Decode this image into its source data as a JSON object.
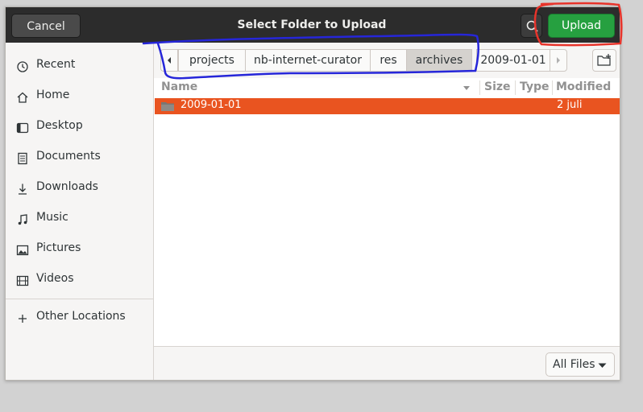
{
  "dialog": {
    "title": "Select Folder to Upload",
    "cancel_label": "Cancel",
    "upload_label": "Upload",
    "search_icon": "search-icon"
  },
  "sidebar": {
    "items": [
      {
        "label": "Recent",
        "icon": "clock-icon"
      },
      {
        "label": "Home",
        "icon": "home-icon"
      },
      {
        "label": "Desktop",
        "icon": "desktop-icon"
      },
      {
        "label": "Documents",
        "icon": "document-icon"
      },
      {
        "label": "Downloads",
        "icon": "download-icon"
      },
      {
        "label": "Music",
        "icon": "music-note-icon"
      },
      {
        "label": "Pictures",
        "icon": "picture-icon"
      },
      {
        "label": "Videos",
        "icon": "film-icon"
      }
    ],
    "other_locations": {
      "label": "Other Locations",
      "icon": "plus-icon"
    }
  },
  "pathbar": {
    "crumbs": [
      "projects",
      "nb-internet-curator",
      "res",
      "archives",
      "2009-01-01"
    ],
    "active_index": 3
  },
  "columns": {
    "name": "Name",
    "size": "Size",
    "type": "Type",
    "modified": "Modified"
  },
  "files": [
    {
      "name": "2009-01-01",
      "size": "",
      "type": "",
      "modified": "2 juli",
      "selected": true,
      "icon": "folder-icon"
    }
  ],
  "filter": {
    "label": "All Files"
  },
  "colors": {
    "selection": "#e95420",
    "upload": "#26a040",
    "titlebar": "#2c2c2c",
    "annotation_blue": "#2626d9",
    "annotation_red": "#e8332a"
  }
}
